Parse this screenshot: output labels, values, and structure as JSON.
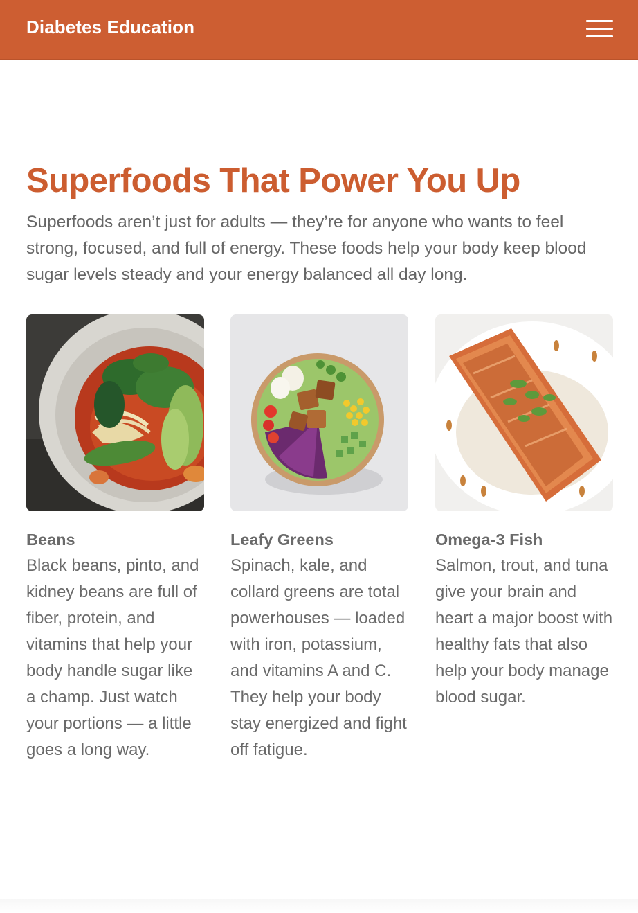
{
  "header": {
    "brand": "Diabetes Education",
    "menu_icon": "hamburger-menu-icon",
    "background_color": "#cd5e32"
  },
  "hero": {
    "title": "Superfoods That Power You Up",
    "intro": "Superfoods aren’t just for adults — they’re for anyone who wants to feel strong, focused, and full of energy. These foods help your body keep blood sugar levels steady and your energy balanced all day long.",
    "title_color": "#cc5d30"
  },
  "cards": [
    {
      "title": "Beans",
      "text": "Black beans, pinto, and kidney beans are full of fiber, protein, and vitamins that help your body handle sugar like a champ. Just watch your portions — a little goes a long way."
    },
    {
      "title": "Leafy Greens",
      "text": "Spinach, kale, and collard greens are total powerhouses — loaded with iron, potassium, and vitamins A and C. They help your body stay energized and fight off fatigue."
    },
    {
      "title": "Omega-3 Fish",
      "text": "Salmon, trout, and tuna give your brain and heart a major boost with healthy fats that also help your body manage blood sugar."
    }
  ]
}
